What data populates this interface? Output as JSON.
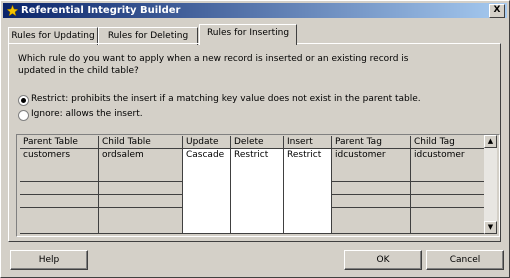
{
  "window": {
    "title": "Referential Integrity Builder",
    "close_label": "X"
  },
  "tabs": [
    {
      "label": "Rules for Updating"
    },
    {
      "label": "Rules for Deleting"
    },
    {
      "label": "Rules for Inserting"
    }
  ],
  "question": "Which rule do you want to apply when a new record is inserted or an existing record is updated in the child table?",
  "options": [
    {
      "label": "Restrict: prohibits the insert if a matching key value does not exist in the parent table.",
      "selected": true
    },
    {
      "label": "Ignore: allows the insert.",
      "selected": false
    }
  ],
  "table": {
    "columns": [
      "Parent Table",
      "Child Table",
      "Update",
      "Delete",
      "Insert",
      "Parent Tag",
      "Child Tag"
    ],
    "rows": [
      [
        "customers",
        "ordsalem",
        "Cascade",
        "Restrict",
        "Restrict",
        "idcustomer",
        "idcustomer"
      ]
    ]
  },
  "buttons": {
    "help": "Help",
    "ok": "OK",
    "cancel": "Cancel"
  },
  "scrollbar": {
    "up": "▲",
    "down": "▼"
  }
}
